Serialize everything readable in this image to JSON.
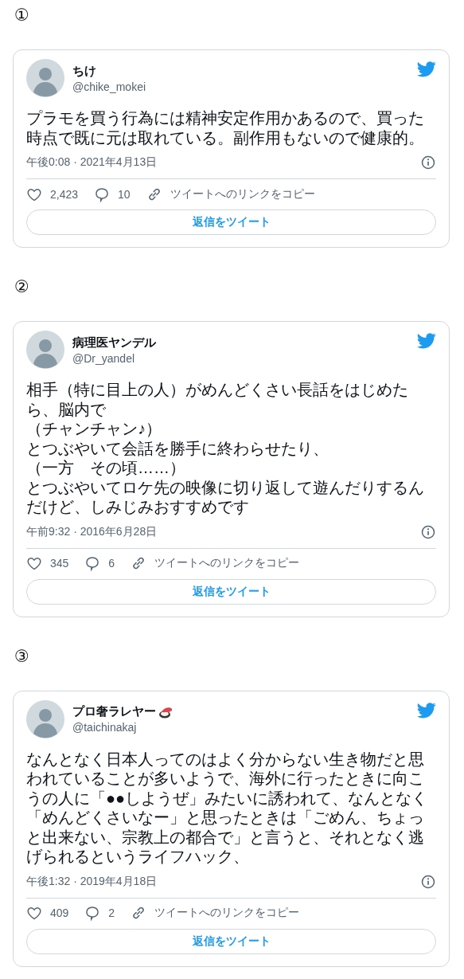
{
  "sections": [
    {
      "marker": "①",
      "tweet": {
        "name": "ちけ",
        "handle": "@chike_mokei",
        "text": [
          "プラモを買う行為には精神安定作用かあるので、買った時点で既に元は取れている。副作用もないので健康的。"
        ],
        "timestamp": "午後0:08 · 2021年4月13日",
        "likes": "2,423",
        "replies": "10",
        "copy_link": "ツイートへのリンクをコピー",
        "reply_button": "返信をツイート"
      }
    },
    {
      "marker": "②",
      "tweet": {
        "name": "病理医ヤンデル",
        "handle": "@Dr_yandel",
        "text": [
          "相手（特に目上の人）がめんどくさい長話をはじめたら、脳内で",
          "（チャンチャン♪）",
          "とつぶやいて会話を勝手に終わらせたり、",
          "（一方　その頃……）",
          "とつぶやいてロケ先の映像に切り返して遊んだりするんだけど、しみじみおすすめです"
        ],
        "timestamp": "午前9:32 · 2016年6月28日",
        "likes": "345",
        "replies": "6",
        "copy_link": "ツイートへのリンクをコピー",
        "reply_button": "返信をツイート"
      }
    },
    {
      "marker": "③",
      "tweet": {
        "name": "プロ奢ラレヤー",
        "has_badge_icon": true,
        "handle": "@taichinakaj",
        "text": [
          "なんとなく日本人ってのはよく分からない生き物だと思われていることが多いようで、海外に行ったときに向こうの人に「●●しようぜ」みたいに誘われて、なんとなく「めんどくさいなー」と思ったときは「ごめん、ちょっと出来ない、宗教上の都合で」と言うと、それとなく逃げられるというライフハック、"
        ],
        "timestamp": "午後1:32 · 2019年4月18日",
        "likes": "409",
        "replies": "2",
        "copy_link": "ツイートへのリンクをコピー",
        "reply_button": "返信をツイート"
      }
    }
  ]
}
